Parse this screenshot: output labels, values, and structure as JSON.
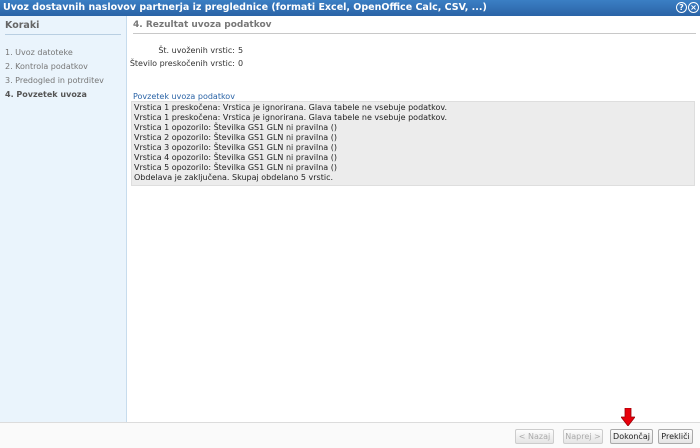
{
  "window": {
    "title": "Uvoz dostavnih naslovov partnerja iz preglednice (formati Excel, OpenOffice Calc, CSV, ...)",
    "help_glyph": "?",
    "close_glyph": "×"
  },
  "sidebar": {
    "header": "Koraki",
    "steps": [
      {
        "label": "1. Uvoz datoteke"
      },
      {
        "label": "2. Kontrola podatkov"
      },
      {
        "label": "3. Predogled in potrditev"
      },
      {
        "label": "4. Povzetek uvoza"
      }
    ],
    "active_step": 3
  },
  "main": {
    "title": "4. Rezultat uvoza podatkov",
    "imported_label": "Št. uvoženih vrstic:",
    "imported_value": "5",
    "skipped_label": "Število preskočenih vrstic:",
    "skipped_value": "0",
    "summary_label": "Povzetek uvoza podatkov",
    "summary_lines": [
      "Vrstica 1 preskočena: Vrstica je ignorirana. Glava tabele ne vsebuje podatkov.",
      "Vrstica 1 preskočena: Vrstica je ignorirana. Glava tabele ne vsebuje podatkov.",
      "Vrstica 1 opozorilo: Številka GS1 GLN ni pravilna ()",
      "Vrstica 2 opozorilo: Številka GS1 GLN ni pravilna ()",
      "Vrstica 3 opozorilo: Številka GS1 GLN ni pravilna ()",
      "Vrstica 4 opozorilo: Številka GS1 GLN ni pravilna ()",
      "Vrstica 5 opozorilo: Številka GS1 GLN ni pravilna ()",
      "Obdelava je zaključena. Skupaj obdelano 5 vrstic."
    ]
  },
  "footer": {
    "back_label": "< Nazaj",
    "next_label": "Naprej >",
    "finish_label": "Dokončaj",
    "cancel_label": "Prekliči"
  },
  "colors": {
    "titlebar": "#2a63a6",
    "sidebar_bg": "#eaf4fc",
    "summary_bg": "#ececec",
    "arrow": "#e8000b"
  },
  "icons": {
    "help": "help-icon",
    "close": "close-icon",
    "pointer": "arrow-down-icon"
  }
}
